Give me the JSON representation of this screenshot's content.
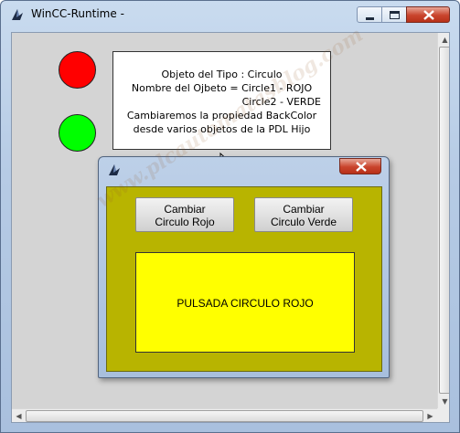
{
  "window": {
    "title": "WinCC-Runtime -",
    "icon": "wincc-runtime-icon",
    "minimize_icon": "minimize-icon",
    "maximize_icon": "maximize-icon",
    "close_icon": "close-icon"
  },
  "canvas": {
    "circle1_color": "#ff0000",
    "circle2_color": "#00ff00",
    "info_lines": [
      "Objeto del Tipo : Circulo",
      "Nombre del Ojbeto = Circle1 - ROJO",
      "Circle2 - VERDE",
      "Cambiaremos la propiedad BackColor",
      "desde varios objetos de la PDL  Hijo"
    ]
  },
  "popup": {
    "icon": "wincc-runtime-icon",
    "close_icon": "close-icon",
    "background_color": "#b8b400",
    "button_red": {
      "line1": "Cambiar",
      "line2": "Circulo Rojo"
    },
    "button_green": {
      "line1": "Cambiar",
      "line2": "Circulo Verde"
    },
    "status_text": "PULSADA CIRCULO ROJO",
    "status_color": "#ffff00"
  },
  "watermark": "www.plcautomatasblog.com"
}
